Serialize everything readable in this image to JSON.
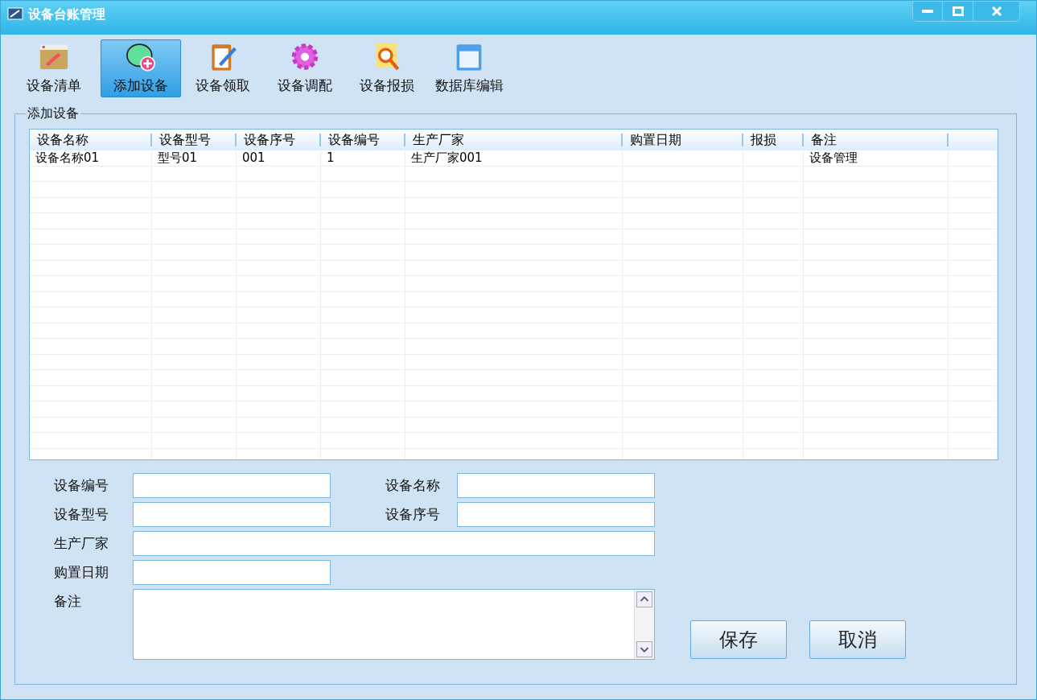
{
  "window": {
    "title": "设备台账管理"
  },
  "toolbar": [
    {
      "label": "设备清单",
      "kind": "list",
      "selected": false
    },
    {
      "label": "添加设备",
      "kind": "add",
      "selected": true
    },
    {
      "label": "设备领取",
      "kind": "clipboard",
      "selected": false
    },
    {
      "label": "设备调配",
      "kind": "gear",
      "selected": false
    },
    {
      "label": "设备报损",
      "kind": "search",
      "selected": false
    },
    {
      "label": "数据库编辑",
      "kind": "calendar",
      "selected": false
    }
  ],
  "group": {
    "title": "添加设备"
  },
  "table": {
    "columns": [
      "设备名称",
      "设备型号",
      "设备序号",
      "设备编号",
      "生产厂家",
      "购置日期",
      "报损",
      "备注"
    ],
    "rows": [
      [
        "设备名称01",
        "型号01",
        "001",
        "1",
        "生产厂家001",
        "",
        "",
        "设备管理"
      ]
    ]
  },
  "form": [
    {
      "label": "设备编号",
      "kind": "short"
    },
    {
      "label": "设备名称",
      "kind": "short"
    },
    {
      "label": "设备型号",
      "kind": "short"
    },
    {
      "label": "设备序号",
      "kind": "short"
    },
    {
      "label": "生产厂家",
      "kind": "wide"
    },
    {
      "label": "购置日期",
      "kind": "short"
    },
    {
      "label": "备注",
      "kind": "area"
    }
  ],
  "buttons": [
    "保存",
    "取消"
  ]
}
